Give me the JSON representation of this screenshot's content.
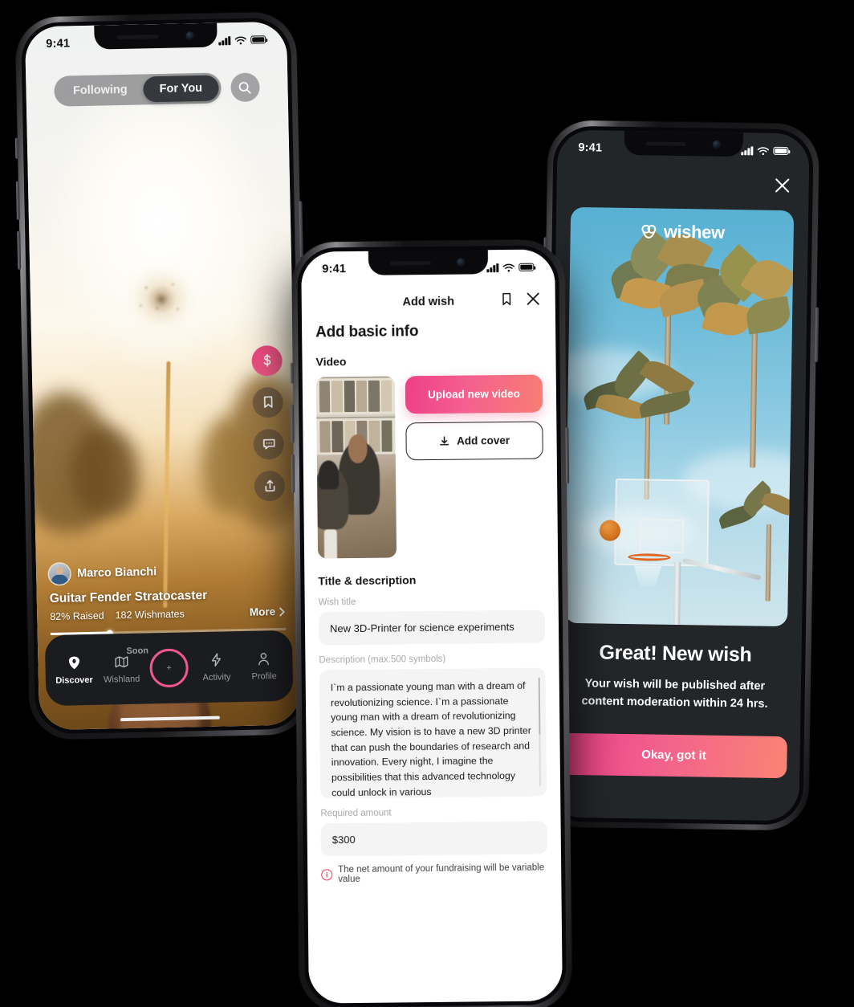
{
  "phone1": {
    "status": {
      "time": "9:41",
      "signal_icon": "cellular-bars-icon",
      "wifi_icon": "wifi-icon",
      "battery_icon": "battery-icon"
    },
    "tabs": {
      "following": "Following",
      "for_you": "For You",
      "active": "For You"
    },
    "search_icon": "search-icon",
    "rail": [
      {
        "name": "donate",
        "icon": "dollar-icon"
      },
      {
        "name": "bookmark",
        "icon": "bookmark-icon"
      },
      {
        "name": "comment",
        "icon": "comment-icon"
      },
      {
        "name": "share",
        "icon": "share-icon"
      }
    ],
    "post": {
      "username": "Marco Bianchi",
      "title": "Guitar Fender Stratocaster",
      "raised": "82% Raised",
      "wishmates": "182 Wishmates",
      "more": "More",
      "progress_percent": 25
    },
    "nav": [
      {
        "label": "Discover",
        "icon": "discover-icon",
        "active": true,
        "badge": ""
      },
      {
        "label": "Wishland",
        "icon": "map-icon",
        "active": false,
        "badge": "Soon"
      },
      {
        "label": "",
        "icon": "plus-icon",
        "active": false,
        "badge": ""
      },
      {
        "label": "Activity",
        "icon": "lightning-icon",
        "active": false,
        "badge": ""
      },
      {
        "label": "Profile",
        "icon": "person-icon",
        "active": false,
        "badge": ""
      }
    ]
  },
  "phone2": {
    "status": {
      "time": "9:41"
    },
    "header": {
      "title": "Add wish",
      "bookmark_icon": "bookmark-icon",
      "close_icon": "close-icon"
    },
    "page_title": "Add basic info",
    "video_section": {
      "label": "Video",
      "upload_label": "Upload new video",
      "cover_label": "Add cover",
      "cover_icon": "download-icon"
    },
    "form_section": {
      "heading": "Title & description",
      "title_label": "Wish title",
      "title_value": "New 3D-Printer for science experiments",
      "description_label": "Description (max.500 symbols)",
      "description_value": "I`m a passionate young man with a dream of revolutionizing science. I`m a passionate young man with a dream of revolutionizing science. My vision is to have a new 3D printer that can push the boundaries of research and innovation. Every night, I imagine the possibilities that this advanced technology could unlock in various",
      "amount_label": "Required amount",
      "amount_value": "$300",
      "note": "The net amount of your fundraising will be variable value",
      "note_icon": "info-icon"
    }
  },
  "phone3": {
    "status": {
      "time": "9:41"
    },
    "close_icon": "close-icon",
    "brand": "wishew",
    "brand_icon": "wishew-logo-icon",
    "heading": "Great! New wish",
    "message": "Your wish will be published after content moderation within 24 hrs.",
    "cta_label": "Okay, got it"
  },
  "colors": {
    "accent_pink": "#ec3f86",
    "accent_coral": "#fa8374",
    "dark_surface": "#232629",
    "nav_surface": "#1b1c20",
    "page_background": "#000000"
  }
}
